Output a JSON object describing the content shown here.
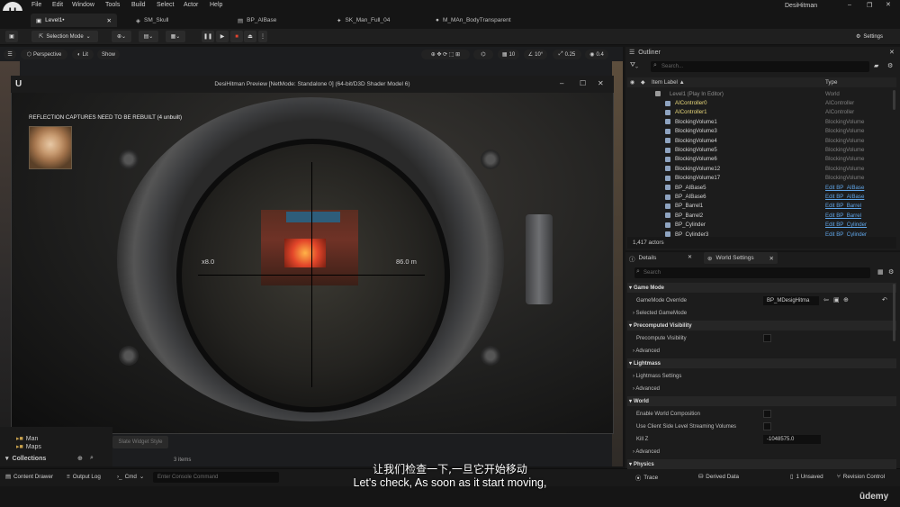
{
  "menu": [
    "File",
    "Edit",
    "Window",
    "Tools",
    "Build",
    "Select",
    "Actor",
    "Help"
  ],
  "tabs": [
    {
      "label": "Level1•",
      "active": true
    },
    {
      "label": "SM_Skull",
      "active": false
    },
    {
      "label": "BP_AIBase",
      "active": false
    },
    {
      "label": "SK_Man_Full_04",
      "active": false
    },
    {
      "label": "M_MAn_BodyTransparent",
      "active": false
    }
  ],
  "user": "DesiHitman",
  "toolbar": {
    "selection_mode": "Selection Mode",
    "settings": "Settings"
  },
  "viewport": {
    "perspective": "Perspective",
    "lit": "Lit",
    "show": "Show",
    "snap_grid": "10",
    "snap_rot": "10°",
    "snap_scale": "0.25",
    "cam_speed": "0.4"
  },
  "pie": {
    "title": "DesiHitman Preview [NetMode: Standalone 0]  (64-bit/D3D Shader Model 6)",
    "warning": "REFLECTION CAPTURES NEED TO BE REBUILT (4 unbuilt)",
    "zoom": "x8.0",
    "distance": "86.0 m"
  },
  "content_browser": {
    "folders": [
      "Man",
      "Maps"
    ],
    "collections": "Collections",
    "slate_style": "Slate Widget Style",
    "items_count": "3 items"
  },
  "statusbar": {
    "content_drawer": "Content Drawer",
    "output_log": "Output Log",
    "cmd": "Cmd",
    "console_placeholder": "Enter Console Command",
    "trace": "Trace",
    "derived_data": "Derived Data",
    "unsaved": "1 Unsaved",
    "revision": "Revision Control"
  },
  "subtitles": {
    "cn": "让我们检查一下,一旦它开始移动",
    "en": "Let's check, As soon as it start moving,"
  },
  "brand": "ûdemy",
  "outliner": {
    "title": "Outliner",
    "search_placeholder": "Search...",
    "col_label": "Item Label ▲",
    "col_type": "Type",
    "actors_count": "1,417 actors",
    "rows": [
      {
        "name": "Level1 (Play In Editor)",
        "type": "World",
        "link": false
      },
      {
        "name": "AIController0",
        "type": "AIController",
        "link": false
      },
      {
        "name": "AIController1",
        "type": "AIController",
        "link": false
      },
      {
        "name": "BlockingVolume1",
        "type": "BlockingVolume",
        "link": false
      },
      {
        "name": "BlockingVolume3",
        "type": "BlockingVolume",
        "link": false
      },
      {
        "name": "BlockingVolume4",
        "type": "BlockingVolume",
        "link": false
      },
      {
        "name": "BlockingVolume5",
        "type": "BlockingVolume",
        "link": false
      },
      {
        "name": "BlockingVolume6",
        "type": "BlockingVolume",
        "link": false
      },
      {
        "name": "BlockingVolume12",
        "type": "BlockingVolume",
        "link": false
      },
      {
        "name": "BlockingVolume17",
        "type": "BlockingVolume",
        "link": false
      },
      {
        "name": "BP_AIBase5",
        "type": "Edit BP_AIBase",
        "link": true
      },
      {
        "name": "BP_AIBase6",
        "type": "Edit BP_AIBase",
        "link": true
      },
      {
        "name": "BP_Barrel1",
        "type": "Edit BP_Barrel",
        "link": true
      },
      {
        "name": "BP_Barrel2",
        "type": "Edit BP_Barrel",
        "link": true
      },
      {
        "name": "BP_Cylinder",
        "type": "Edit BP_Cylinder",
        "link": true
      },
      {
        "name": "BP_Cylinder3",
        "type": "Edit BP_Cylinder",
        "link": true
      }
    ]
  },
  "details": {
    "tab_details": "Details",
    "tab_world": "World Settings",
    "search_placeholder": "Search",
    "sections": [
      {
        "title": "Game Mode",
        "rows": [
          {
            "label": "GameMode Override",
            "value": "BP_MDesigHitma"
          },
          {
            "label": "Selected GameMode",
            "value": ""
          }
        ]
      },
      {
        "title": "Precomputed Visibility",
        "rows": [
          {
            "label": "Precompute Visibility",
            "value": "checkbox"
          },
          {
            "label": "Advanced",
            "value": ""
          }
        ]
      },
      {
        "title": "Lightmass",
        "rows": [
          {
            "label": "Lightmass Settings",
            "value": ""
          },
          {
            "label": "Advanced",
            "value": ""
          }
        ]
      },
      {
        "title": "World",
        "rows": [
          {
            "label": "Enable World Composition",
            "value": "checkbox"
          },
          {
            "label": "Use Client Side Level Streaming Volumes",
            "value": "checkbox"
          },
          {
            "label": "Kill Z",
            "value": "-1048575.0"
          },
          {
            "label": "Advanced",
            "value": ""
          }
        ]
      },
      {
        "title": "Physics",
        "rows": []
      }
    ]
  }
}
